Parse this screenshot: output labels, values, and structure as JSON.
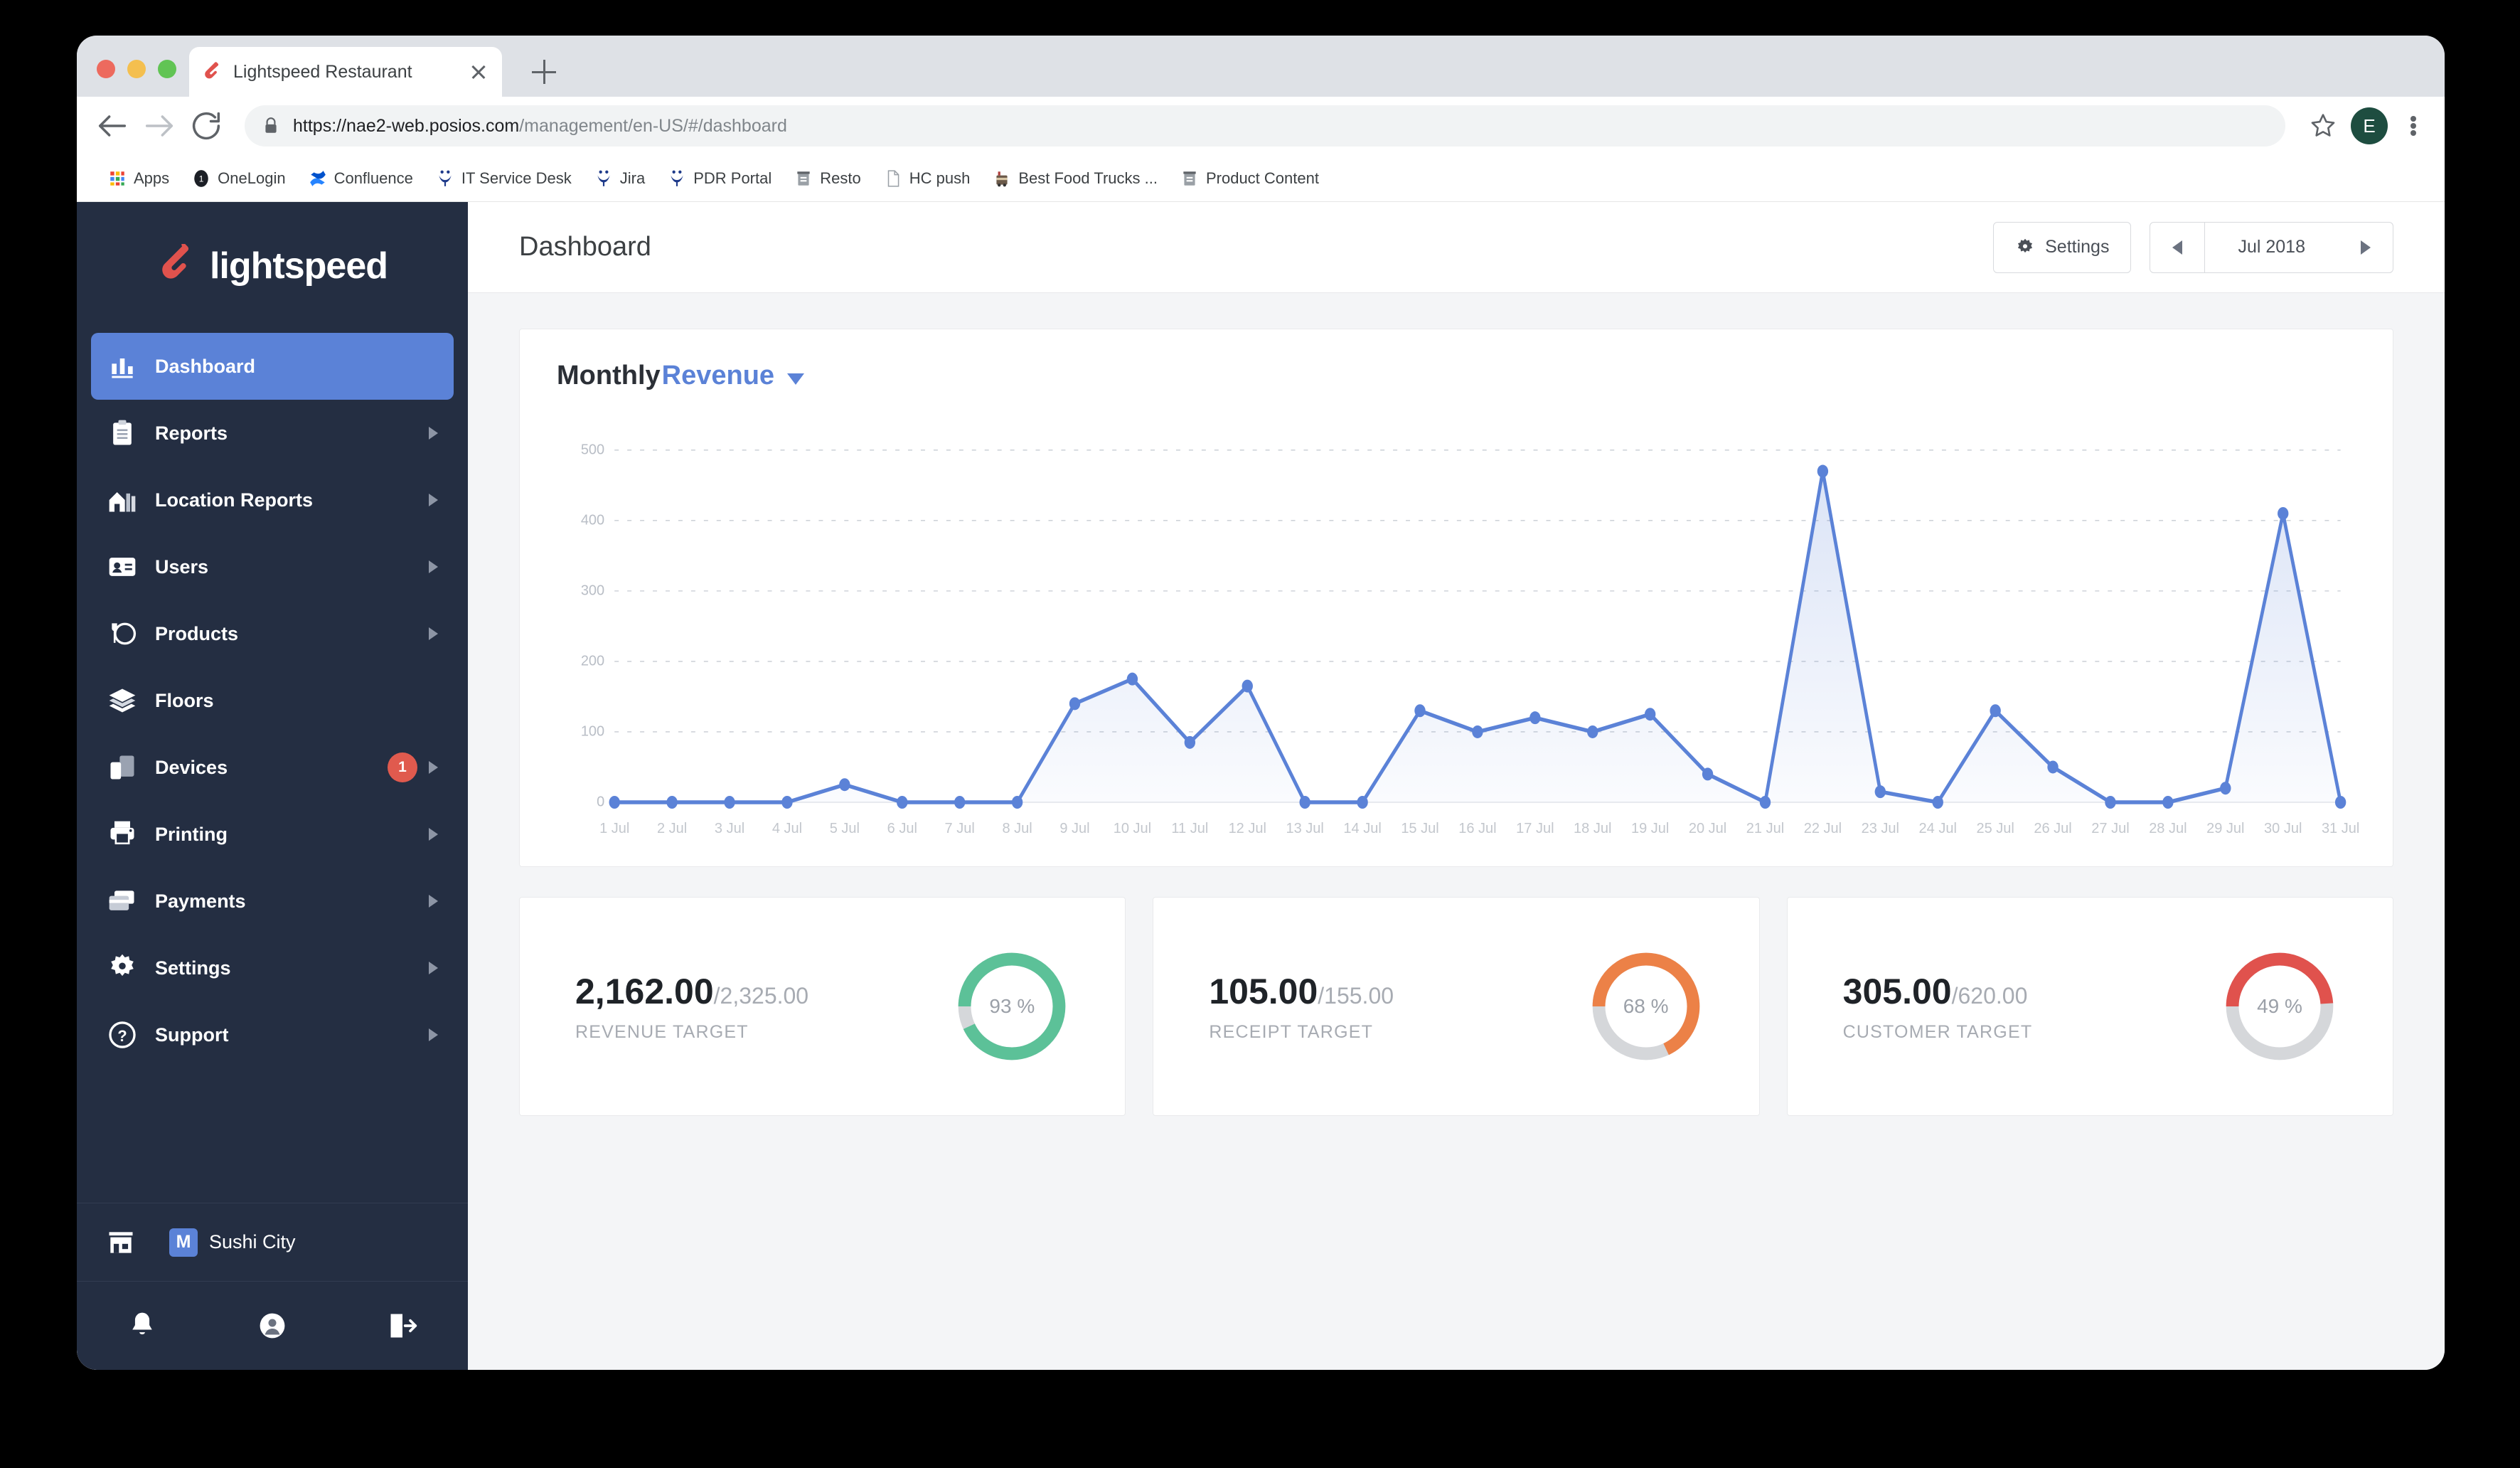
{
  "browser": {
    "tab": {
      "title": "Lightspeed Restaurant",
      "favicon": "lightspeed-flame-icon"
    },
    "new_tab_label": "+",
    "url_secure": "https://nae2-web.posios.com",
    "url_path": "/management/en-US/#/dashboard",
    "profile_initial": "E",
    "bookmarks": [
      {
        "label": "Apps",
        "icon": "apps-grid-icon"
      },
      {
        "label": "OneLogin",
        "icon": "onelogin-icon"
      },
      {
        "label": "Confluence",
        "icon": "confluence-icon"
      },
      {
        "label": "IT Service Desk",
        "icon": "jira-people-icon"
      },
      {
        "label": "Jira",
        "icon": "jira-people-icon"
      },
      {
        "label": "PDR Portal",
        "icon": "jira-people-icon"
      },
      {
        "label": "Resto",
        "icon": "folder-icon"
      },
      {
        "label": "HC push",
        "icon": "document-icon"
      },
      {
        "label": "Best Food Trucks ...",
        "icon": "food-truck-icon"
      },
      {
        "label": "Product Content",
        "icon": "folder-icon"
      }
    ]
  },
  "sidebar": {
    "brand": "lightspeed",
    "items": [
      {
        "label": "Dashboard",
        "icon": "bar-chart-icon",
        "active": true,
        "chevron": false
      },
      {
        "label": "Reports",
        "icon": "clipboard-icon",
        "active": false,
        "chevron": true
      },
      {
        "label": "Location Reports",
        "icon": "building-icon",
        "active": false,
        "chevron": true
      },
      {
        "label": "Users",
        "icon": "id-card-icon",
        "active": false,
        "chevron": true
      },
      {
        "label": "Products",
        "icon": "dining-icon",
        "active": false,
        "chevron": true
      },
      {
        "label": "Floors",
        "icon": "layers-icon",
        "active": false,
        "chevron": false
      },
      {
        "label": "Devices",
        "icon": "devices-icon",
        "active": false,
        "chevron": true,
        "badge": "1"
      },
      {
        "label": "Printing",
        "icon": "printer-icon",
        "active": false,
        "chevron": true
      },
      {
        "label": "Payments",
        "icon": "credit-card-icon",
        "active": false,
        "chevron": true
      },
      {
        "label": "Settings",
        "icon": "gear-icon",
        "active": false,
        "chevron": true
      },
      {
        "label": "Support",
        "icon": "question-circle-icon",
        "active": false,
        "chevron": true
      }
    ],
    "store": {
      "icon": "storefront-icon",
      "avatar_initial": "M",
      "name": "Sushi City"
    },
    "footer_icons": [
      "bell-icon",
      "user-circle-icon",
      "logout-icon"
    ]
  },
  "header": {
    "title": "Dashboard",
    "settings_label": "Settings",
    "settings_icon": "gear-icon",
    "date_prev_icon": "chevron-left-icon",
    "date_value": "Jul 2018",
    "date_next_icon": "chevron-right-icon"
  },
  "chart_card": {
    "title_static": "Monthly",
    "title_metric": "Revenue",
    "dropdown_icon": "chevron-down-icon"
  },
  "chart_data": {
    "type": "area",
    "title": "MonthlyRevenue",
    "xlabel": "",
    "ylabel": "",
    "grid": true,
    "legend": "none",
    "ylim": [
      0,
      520
    ],
    "yticks": [
      0,
      100,
      200,
      300,
      400,
      500
    ],
    "categories": [
      "1 Jul",
      "2 Jul",
      "3 Jul",
      "4 Jul",
      "5 Jul",
      "6 Jul",
      "7 Jul",
      "8 Jul",
      "9 Jul",
      "10 Jul",
      "11 Jul",
      "12 Jul",
      "13 Jul",
      "14 Jul",
      "15 Jul",
      "16 Jul",
      "17 Jul",
      "18 Jul",
      "19 Jul",
      "20 Jul",
      "21 Jul",
      "22 Jul",
      "23 Jul",
      "24 Jul",
      "25 Jul",
      "26 Jul",
      "27 Jul",
      "28 Jul",
      "29 Jul",
      "30 Jul",
      "31 Jul"
    ],
    "series": [
      {
        "name": "Revenue",
        "color": "#5b82d7",
        "values": [
          0,
          0,
          0,
          0,
          25,
          0,
          0,
          0,
          140,
          175,
          85,
          165,
          0,
          0,
          130,
          100,
          120,
          100,
          125,
          40,
          0,
          470,
          15,
          0,
          130,
          50,
          0,
          0,
          20,
          410,
          0
        ]
      }
    ]
  },
  "kpis": [
    {
      "value": "2,162.00",
      "denominator": "/2,325.00",
      "label": "REVENUE TARGET",
      "percent_text": "93 %",
      "percent": 93,
      "color": "#5cc198"
    },
    {
      "value": "105.00",
      "denominator": "/155.00",
      "label": "RECEIPT TARGET",
      "percent_text": "68 %",
      "percent": 68,
      "color": "#ec8147"
    },
    {
      "value": "305.00",
      "denominator": "/620.00",
      "label": "CUSTOMER TARGET",
      "percent_text": "49 %",
      "percent": 49,
      "color": "#e0524d"
    }
  ]
}
